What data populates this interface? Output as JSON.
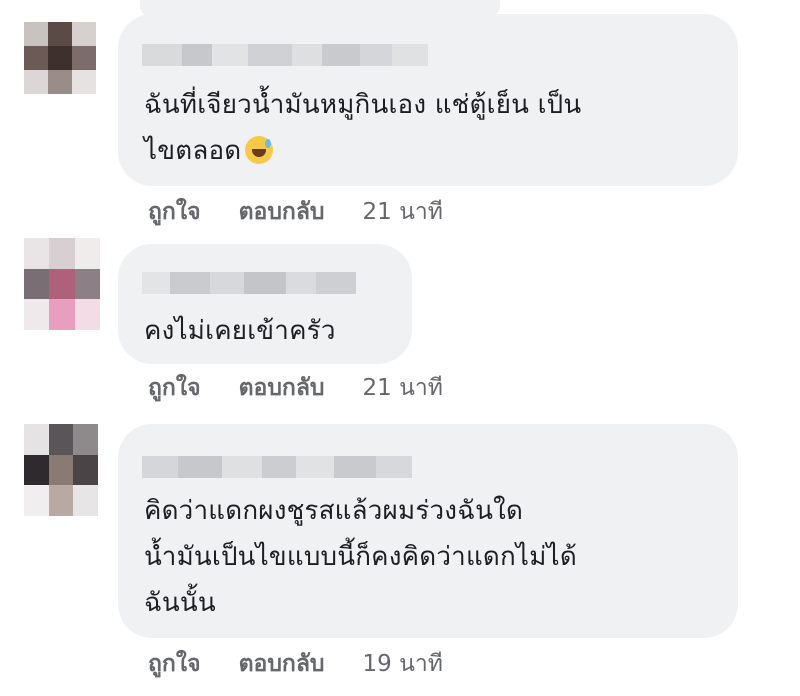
{
  "comments": [
    {
      "text": "ฉันที่เจียวน้ำมันหมูกินเอง แช่ตู้เย็น เป็น\nไขตลอด",
      "emoji": "sweat-smile-emoji",
      "like_label": "ถูกใจ",
      "reply_label": "ตอบกลับ",
      "time": "21 นาที"
    },
    {
      "text": "คงไม่เคยเข้าครัว",
      "like_label": "ถูกใจ",
      "reply_label": "ตอบกลับ",
      "time": "21 นาที"
    },
    {
      "text": "คิดว่าแดกผงชูรสแล้วผมร่วงฉันใด\nน้ำมันเป็นไขแบบนี้ก็คงคิดว่าแดกไม่ได้\nฉันนั้น",
      "like_label": "ถูกใจ",
      "reply_label": "ตอบกลับ",
      "time": "19 นาที"
    }
  ],
  "colors": {
    "bubble": "#f0f1f3",
    "text": "#1c1e21",
    "meta": "#65676b"
  }
}
